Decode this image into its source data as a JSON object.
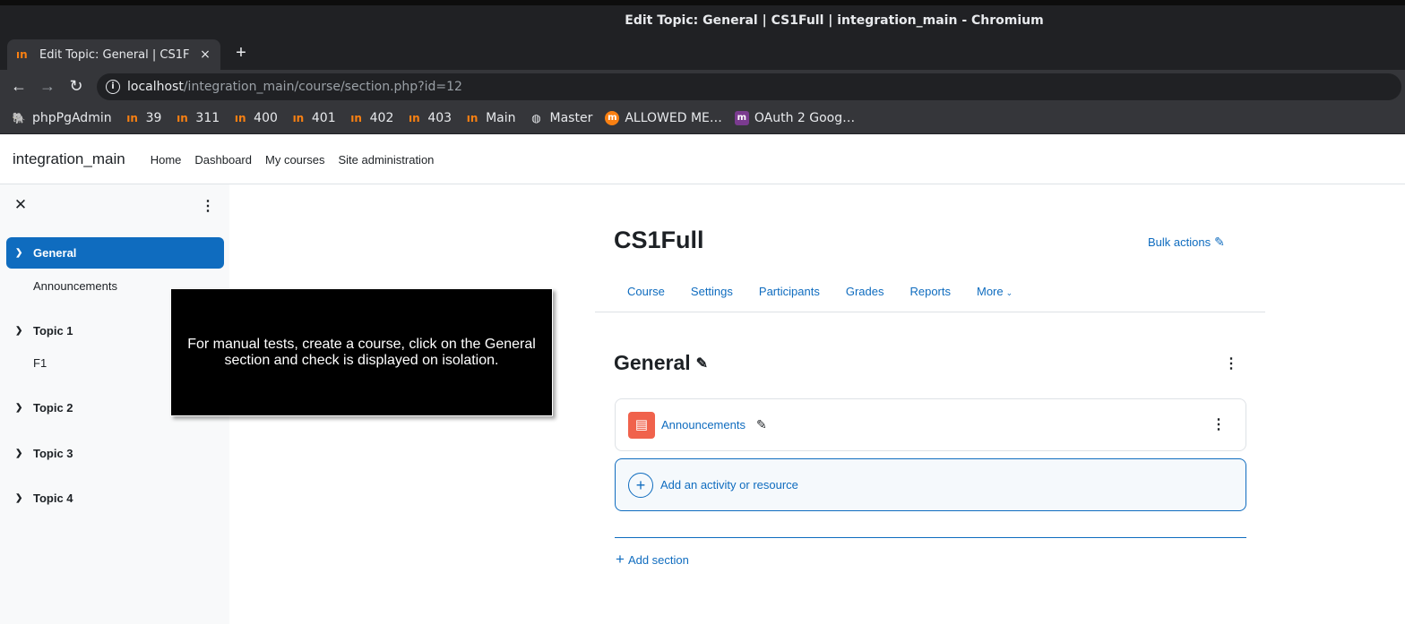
{
  "window": {
    "title": "Edit Topic: General | CS1Full | integration_main - Chromium"
  },
  "tab": {
    "title": "Edit Topic: General | CS1F",
    "close": "×",
    "new_tab": "+"
  },
  "toolbar": {
    "url_host": "localhost",
    "url_path": "/integration_main/course/section.php?id=12"
  },
  "bookmarks": [
    {
      "label": "phpPgAdmin",
      "icon": "elephant-icon"
    },
    {
      "label": "39",
      "icon": "moodle-icon"
    },
    {
      "label": "311",
      "icon": "moodle-icon"
    },
    {
      "label": "400",
      "icon": "moodle-icon"
    },
    {
      "label": "401",
      "icon": "moodle-icon"
    },
    {
      "label": "402",
      "icon": "moodle-icon"
    },
    {
      "label": "403",
      "icon": "moodle-icon"
    },
    {
      "label": "Main",
      "icon": "moodle-icon"
    },
    {
      "label": "Master",
      "icon": "globe-icon"
    },
    {
      "label": "ALLOWED ME…",
      "icon": "moodle-circle-icon"
    },
    {
      "label": "OAuth 2 Goog…",
      "icon": "moodle-square-icon"
    }
  ],
  "site": {
    "name": "integration_main",
    "nav": [
      "Home",
      "Dashboard",
      "My courses",
      "Site administration"
    ]
  },
  "drawer": {
    "close": "✕",
    "sections": [
      {
        "label": "General",
        "items": [
          "Announcements"
        ],
        "active": true
      },
      {
        "label": "Topic 1",
        "items": [
          "F1"
        ]
      },
      {
        "label": "Topic 2",
        "items": []
      },
      {
        "label": "Topic 3",
        "items": []
      },
      {
        "label": "Topic 4",
        "items": []
      }
    ]
  },
  "tour": {
    "text": "For manual tests, create a course, click on the General section and check is displayed on isolation."
  },
  "course": {
    "title": "CS1Full",
    "bulk_actions": "Bulk actions",
    "tabs": [
      "Course",
      "Settings",
      "Participants",
      "Grades",
      "Reports",
      "More"
    ],
    "section_title": "General",
    "activity_name": "Announcements",
    "add_activity": "Add an activity or resource",
    "add_section": "Add section"
  },
  "colors": {
    "primary": "#0f6cbf",
    "forum_icon": "#f0624c",
    "moodle_orange": "#f98012"
  }
}
